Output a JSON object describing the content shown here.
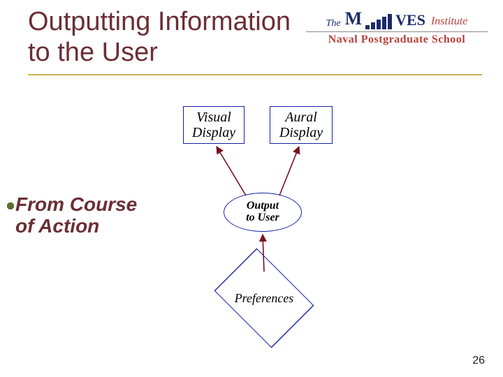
{
  "title_line1": "Outputting Information",
  "title_line2": "to the User",
  "side_label_line1": "From Course",
  "side_label_line2": "of Action",
  "visual_box_line1": "Visual",
  "visual_box_line2": "Display",
  "aural_box_line1": "Aural",
  "aural_box_line2": "Display",
  "ellipse_line1": "Output",
  "ellipse_line2": "to User",
  "diamond_label": "Preferences",
  "logo": {
    "the": "The",
    "m": "M",
    "ves": "VES",
    "institute": "Institute",
    "nps": "Naval Postgraduate School"
  },
  "page_number": "26"
}
